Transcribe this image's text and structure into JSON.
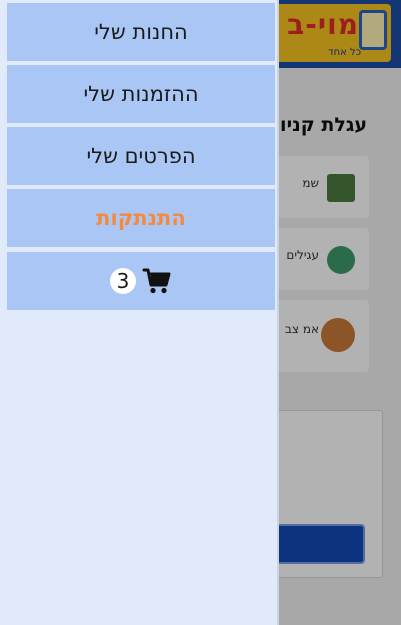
{
  "background": {
    "logo_text": "מוי-ב",
    "logo_subtitle": "כל אחד",
    "cart_title": "עגלת קניות",
    "items": [
      {
        "name": "שמ"
      },
      {
        "name": "עגילים"
      },
      {
        "name": "אמ צב"
      }
    ]
  },
  "drawer": {
    "items": [
      {
        "label": "החנות שלי"
      },
      {
        "label": "ההזמנות שלי"
      },
      {
        "label": "הפרטים שלי"
      },
      {
        "label": "התנתקות"
      }
    ],
    "cart_count": "3"
  },
  "colors": {
    "drawer_bg": "#e0eafb",
    "menu_item_bg": "#a9c6f5",
    "logout_text": "#f58a3c",
    "header_blue": "#1f4ea6"
  }
}
